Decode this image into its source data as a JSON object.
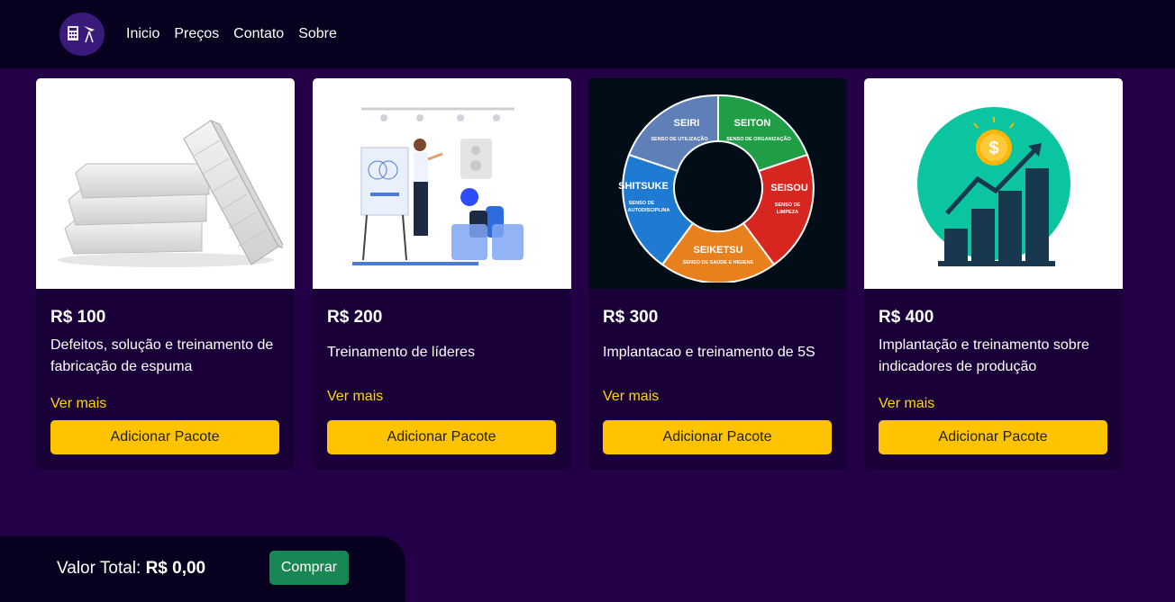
{
  "nav": {
    "links": [
      "Inicio",
      "Preços",
      "Contato",
      "Sobre"
    ]
  },
  "cards": [
    {
      "price": "R$ 100",
      "description": "Defeitos, solução e treinamento de fabricação de espuma",
      "more": "Ver mais",
      "button": "Adicionar Pacote",
      "image": "mattress-stack"
    },
    {
      "price": "R$ 200",
      "description": "Treinamento de líderes",
      "more": "Ver mais",
      "button": "Adicionar Pacote",
      "image": "presentation-illustration"
    },
    {
      "price": "R$ 300",
      "description": "Implantacao e treinamento de 5S",
      "more": "Ver mais",
      "button": "Adicionar Pacote",
      "image": "5s-wheel"
    },
    {
      "price": "R$ 400",
      "description": "Implantação e treinamento sobre indicadores de produção",
      "more": "Ver mais",
      "button": "Adicionar Pacote",
      "image": "growth-chart"
    }
  ],
  "wheel": {
    "seiri": "SEIRI",
    "seiri_sub": "SENSO DE UTILIZAÇÃO",
    "seiton": "SEITON",
    "seiton_sub": "SENSO DE ORGANIZAÇÃO",
    "seisou": "SEISOU",
    "seisou_sub1": "SENSO DE",
    "seisou_sub2": "LIMPEZA",
    "seiketsu": "SEIKETSU",
    "seiketsu_sub": "SENSO DE SAÚDE E HIGIENE",
    "shitsuke": "SHITSUKE",
    "shitsuke_sub1": "SENSO DE",
    "shitsuke_sub2": "AUTODISCIPLINA"
  },
  "coin_symbol": "$",
  "footer": {
    "total_label": "Valor Total:",
    "total_value": "R$ 0,00",
    "buy_label": "Comprar"
  },
  "colors": {
    "background": "#240046",
    "navbar": "#08001f",
    "accent_yellow": "#ffc300",
    "link_yellow": "#ffd60a",
    "buy_green": "#198754"
  }
}
